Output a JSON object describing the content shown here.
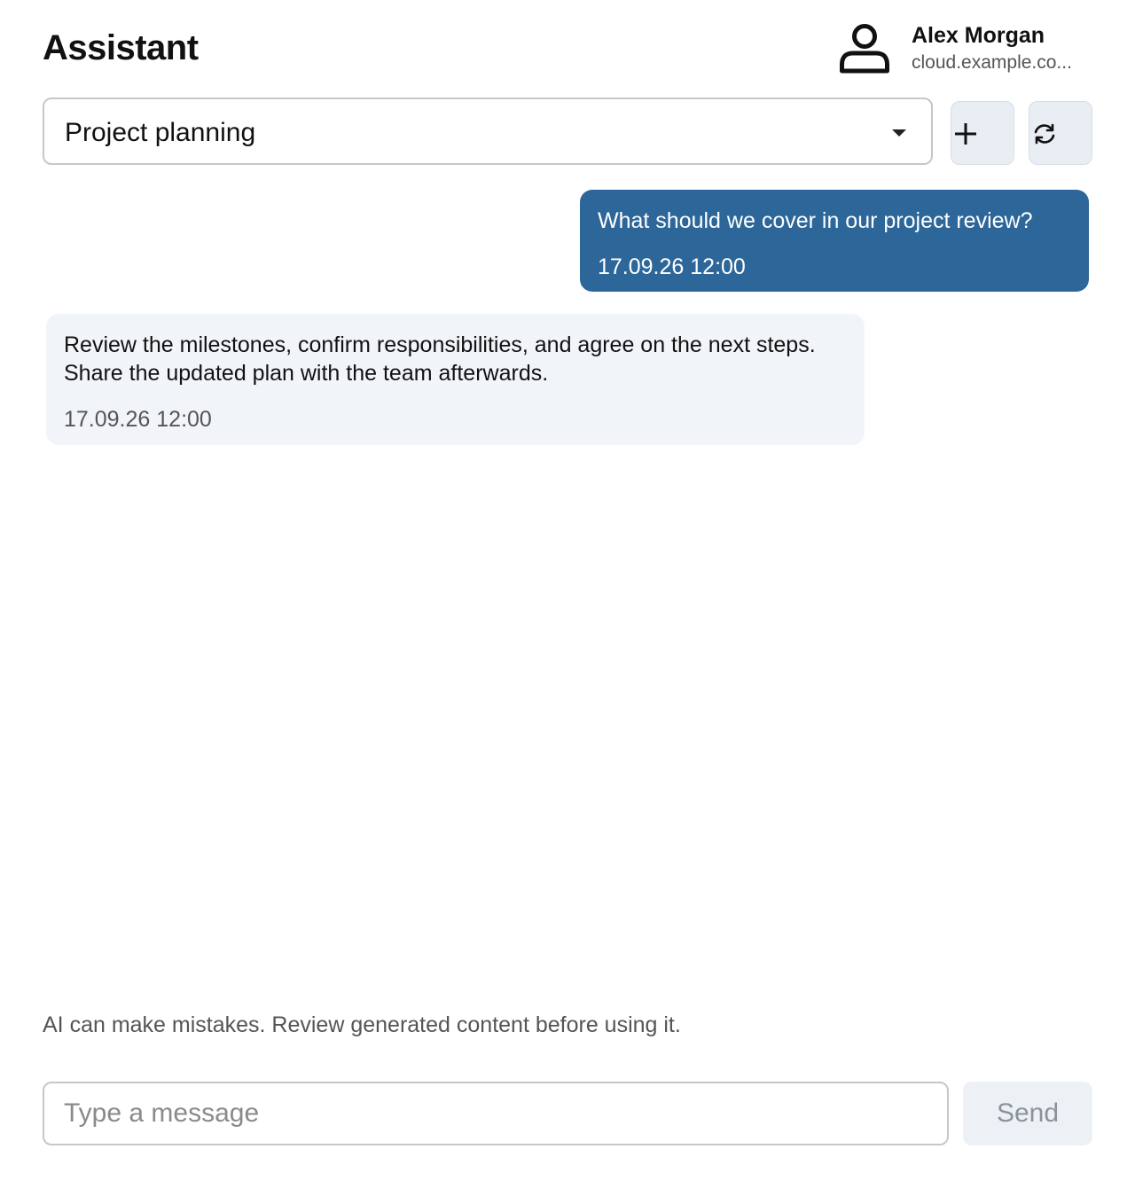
{
  "header": {
    "title": "Assistant",
    "user": {
      "name": "Alex Morgan",
      "host": "cloud.example.co..."
    }
  },
  "conversation": {
    "selected": "Project planning",
    "icons": {
      "new": "plus-icon",
      "refresh": "refresh-icon"
    }
  },
  "messages": [
    {
      "role": "user",
      "text": "What should we cover in our project review?",
      "time": "17.09.26 12:00"
    },
    {
      "role": "assistant",
      "text": "Review the milestones, confirm responsibilities, and agree on the next steps. Share the updated plan with the team afterwards.",
      "time": "17.09.26 12:00"
    }
  ],
  "footer": {
    "disclaimer": "AI can make mistakes. Review generated content before using it.",
    "input_placeholder": "Type a message",
    "input_value": "",
    "send_label": "Send"
  },
  "colors": {
    "user_bubble": "#2d6699",
    "assistant_bubble": "#f1f5f9",
    "button_bg": "#e9eef4"
  }
}
